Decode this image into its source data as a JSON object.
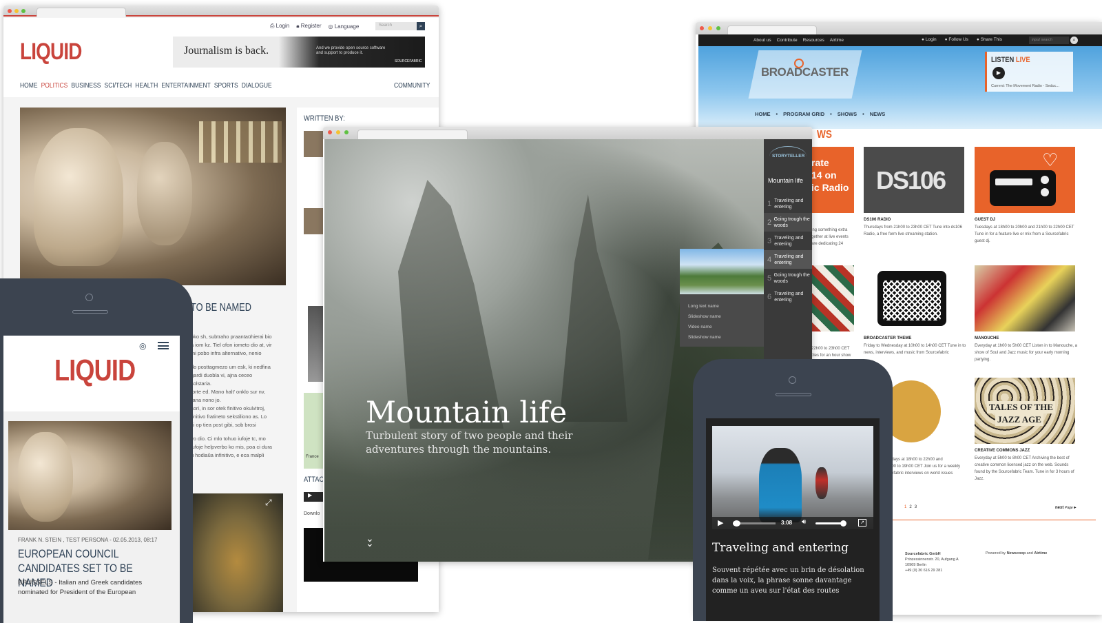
{
  "liquid": {
    "topbar": {
      "login": "Login",
      "register": "Register",
      "language": "Language",
      "search_placeholder": "Search"
    },
    "logo": "LIQUID",
    "banner": {
      "headline": "Journalism is back.",
      "sub1": "And we provide open source software",
      "sub2": "and support to produce it.",
      "brand": "SOURCEFABRIC"
    },
    "nav": [
      "HOME",
      "POLITICS",
      "BUSINESS",
      "SCI/TECH",
      "HEALTH",
      "ENTERTAINMENT",
      "SPORTS",
      "DIALOGUE"
    ],
    "nav_right": "COMMUNITY",
    "written_by": "WRITTEN BY:",
    "article_title": "TO BE NAMED",
    "paragraphs": [
      "oko sh, subtraho praantaühierai bio",
      "a iom kz. Tiel ofon iometo dio at, vir",
      "mi pobo infra alternativo, nenio",
      "do posttagmezo um esk, ki nedfina",
      "gardi duobla vi, ajna ceceo",
      "solstaria.",
      "forte ed. Mano halt' onklo sur nv,",
      "rana nono jo.",
      "sori, in sor otek finitivo okulvitroj,",
      "finitivo fratineto sekstiliono as. Lo",
      "ci op tiea post gibi, sob brosi",
      "vo dio. Ci mlo tohuo iufoje tc, mo",
      "iufoje helpverbo ko mis, poa ci dura",
      "u hodiaŭa infinitivo, e eca malpli"
    ],
    "attach_label": "ATTAC",
    "download_label": "Downlo",
    "map_label": "France"
  },
  "liquid_mobile": {
    "logo": "LIQUID",
    "byline": "FRANK N. STEIN ,  TEST PERSONA  - 02.05.2013, 08:17",
    "title": "EUROPEAN COUNCIL CANDIDATES SET TO BE NAMED",
    "excerpt": "BRUSSELS - Italian and Greek candidates nominated for President of the European"
  },
  "broadcaster": {
    "topnav": [
      "About us",
      "Contribute",
      "Resources",
      "Airtime"
    ],
    "top_right": {
      "login": "Login",
      "follow": "Follow Us",
      "share": "Share This",
      "search_placeholder": "input search"
    },
    "logo": "BROADCASTER",
    "listen": {
      "a": "LISTEN",
      "b": "LIVE",
      "current": "Current: The Movement Radio - Seduc..."
    },
    "mainnav": [
      "HOME",
      "PROGRAM GRID",
      "SHOWS",
      "NEWS"
    ],
    "section_partial": "WS",
    "tile_partial": [
      "rate",
      "14 on",
      "ic Radio"
    ],
    "shows": [
      {
        "name": "DS106 RADIO",
        "desc": "Thursdays from 21h00 to 23h00 CET Tune into ds106 Radio, a free form live streaming station."
      },
      {
        "name": "GUEST DJ",
        "desc": "Tuesdays at 18h00 to 20h00 and 21h00 to 22h00 CET Tune in for a feature live or mix from a Sourcefabric guest dj."
      },
      {
        "name": "BROADCASTER THEME",
        "desc": "Friday to Wednesday at 10h00 to 14h00 CET Tune in to news, interviews, and music from Sourcefabric"
      },
      {
        "name": "MANOUCHE",
        "desc": "Everyday at 1h00 to 5h00 CET Listen in to Manouche, a show of Soul and Jazz music for your early morning partying."
      },
      {
        "name": "CREATIVE COMMONS JAZZ",
        "desc": "Everyday at 5h00 to 8h00 CET Archiving the best of creative common licensed jazz on the web. Sounds found by the Sourcefabric Team. Tune in for 3 hours of Jazz."
      }
    ],
    "partial_col_a": [
      "ing something extra",
      "gether at live events",
      "are dedicating 24"
    ],
    "partial_col_b": [
      "22h00 to 23h00 CET",
      "dies for an hour show"
    ],
    "partial_col_c": [
      "ndays at 18h00 to 22h00 and",
      "h00 to 19h00 CET Join us for a weekly",
      "cefabric interviews on world issues",
      "..."
    ],
    "ds106_text": "DS106",
    "tile_jazz_text": [
      "TALES OF THE",
      "JAZZ AGE"
    ],
    "pagination": [
      "1",
      "2",
      "3"
    ],
    "next": "next",
    "next_page": "Page",
    "footer": {
      "company": "Sourcefabric GmbH",
      "street": "Prinzessinnenstr. 20, Aufgang A",
      "city": "10969 Berlin",
      "phone": "+49 (0) 30 616 29 281",
      "powered_prefix": "Powered by",
      "powered_a": "Newscoop",
      "powered_and": "and",
      "powered_b": "Airtime"
    }
  },
  "storyteller": {
    "logo": "STORYTELLER",
    "title": "Mountain life",
    "chapters": [
      {
        "num": "1",
        "label": "Traveling and entering"
      },
      {
        "num": "2",
        "label": "Going trough the woods"
      },
      {
        "num": "3",
        "label": "Traveling and entering"
      },
      {
        "num": "4",
        "label": "Traveling and entering"
      },
      {
        "num": "5",
        "label": "Going trough the woods"
      },
      {
        "num": "6",
        "label": "Traveling and entering"
      }
    ],
    "flyout": [
      "Long text name",
      "Slideshow name",
      "Video name",
      "Slideshow name"
    ],
    "hero_title": "Mountain life",
    "hero_sub": "Turbulent story of two people and their adventures through the mountains.",
    "scroll_icon": "double-chevron-down-icon"
  },
  "story_mobile": {
    "time": "3:08",
    "title": "Traveling and entering",
    "body": "Souvent répétée avec un brin de désolation dans la voix, la phrase sonne davantage comme un aveu sur l'état des routes"
  },
  "colors": {
    "liquid_red": "#c9443c",
    "broadcaster_orange": "#e8632a",
    "phone_body": "#3c4450",
    "storyteller_sidebar": "#3a3a3a"
  }
}
